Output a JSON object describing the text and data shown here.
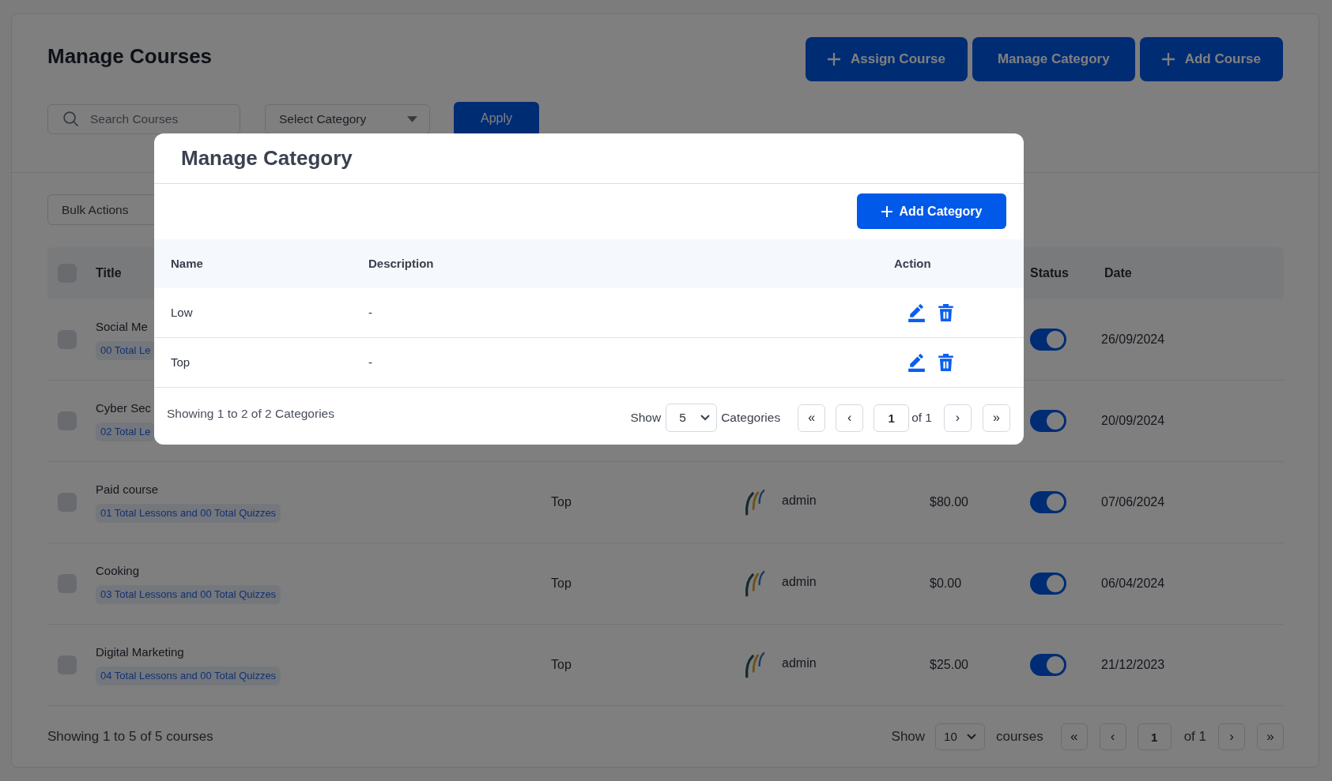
{
  "page": {
    "title": "Manage Courses",
    "actions": [
      {
        "label": "Assign Course",
        "kind": "add"
      },
      {
        "label": "Manage Category",
        "kind": "plain"
      },
      {
        "label": "Add Course",
        "kind": "add"
      }
    ]
  },
  "filters": {
    "search": {
      "placeholder": "Search Courses"
    },
    "category": {
      "placeholder": "Select Category"
    },
    "apply": "Apply"
  },
  "bulk_actions": {
    "placeholder": "Bulk Actions"
  },
  "courses_table": {
    "header": {
      "checked": false,
      "title": "Title",
      "status": "Status",
      "date": "Date"
    },
    "rows": [
      {
        "checked": false,
        "title": "Social Me",
        "lessons": "00 Total Le",
        "on": true,
        "date": "26/09/2024"
      },
      {
        "checked": false,
        "title": "Cyber Sec",
        "lessons": "02 Total Le",
        "on": true,
        "date": "20/09/2024"
      },
      {
        "checked": false,
        "title": "Paid course",
        "lessons": "01 Total Lessons and 00 Total Quizzes",
        "category": "Top",
        "author": "admin",
        "price": "$80.00",
        "on": true,
        "date": "07/06/2024"
      },
      {
        "checked": false,
        "title": "Cooking",
        "lessons": "03 Total Lessons and 00 Total Quizzes",
        "category": "Top",
        "author": "admin",
        "price": "$0.00",
        "on": true,
        "date": "06/04/2024"
      },
      {
        "checked": false,
        "title": "Digital Marketing",
        "lessons": "04 Total Lessons and 00 Total Quizzes",
        "category": "Top",
        "author": "admin",
        "price": "$25.00",
        "on": true,
        "date": "21/12/2023"
      }
    ],
    "footer": {
      "summary": "Showing 1 to 5 of 5 courses",
      "show": "Show",
      "page_size": "10",
      "unit": "courses",
      "first": "«",
      "prev": "‹",
      "page": "1",
      "of": "of 1",
      "next": "›",
      "last": "»"
    }
  },
  "category_modal": {
    "title": "Manage Category",
    "add_button": "Add Category",
    "columns": {
      "name": "Name",
      "description": "Description",
      "action": "Action"
    },
    "rows": [
      {
        "name": "Low",
        "description": "-"
      },
      {
        "name": "Top",
        "description": "-"
      }
    ],
    "footer": {
      "summary": "Showing 1 to 2 of 2 Categories",
      "show": "Show",
      "page_size": "5",
      "unit": "Categories",
      "first": "«",
      "prev": "‹",
      "page": "1",
      "of": "of 1",
      "next": "›",
      "last": "»"
    }
  }
}
